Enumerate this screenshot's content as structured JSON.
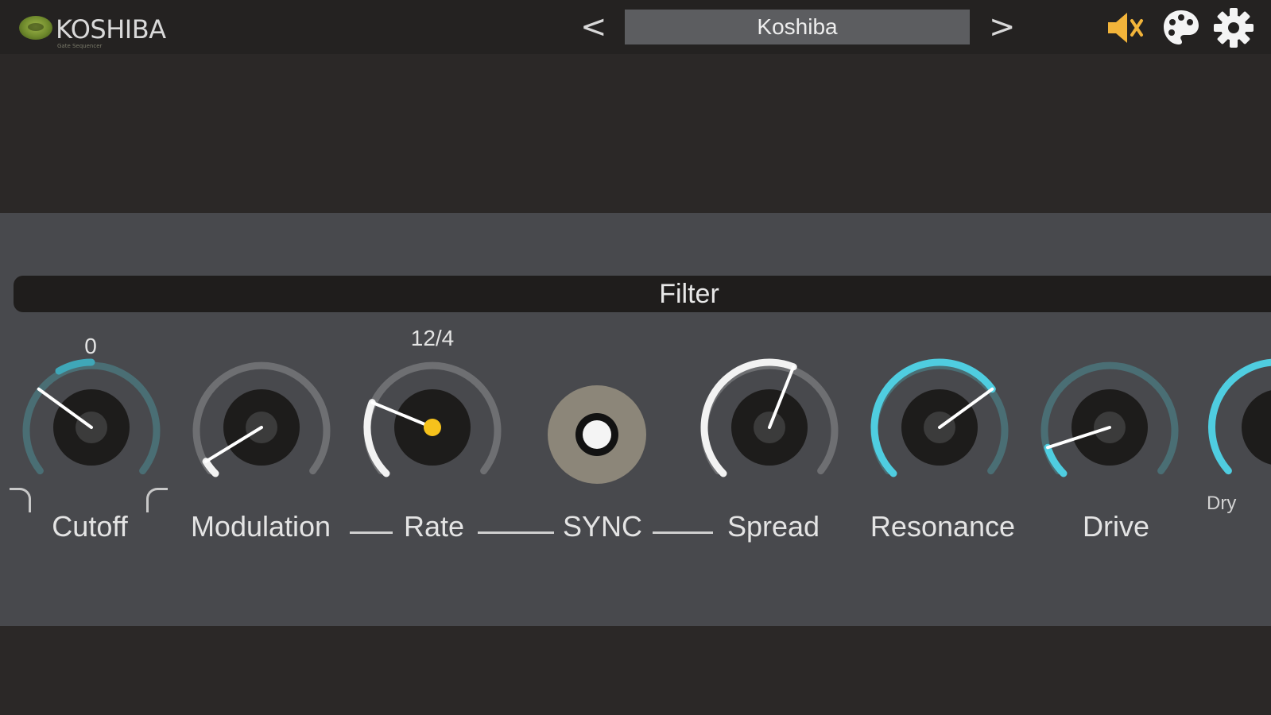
{
  "app": {
    "logo_text": "KOSHIBA",
    "logo_subtitle": "Gate Sequencer"
  },
  "header": {
    "prev_label": "<",
    "next_label": ">",
    "preset_name": "Koshiba",
    "icons": [
      "speaker-mute-icon",
      "palette-icon",
      "gear-icon"
    ]
  },
  "filter": {
    "title": "Filter",
    "dry_label": "Dry",
    "knobs": [
      {
        "label": "Cutoff",
        "value_text": "0",
        "level": 0.5,
        "arc": "teal"
      },
      {
        "label": "Modulation",
        "level": 0.05,
        "arc": "white"
      },
      {
        "label": "Rate",
        "value_text": "12/4",
        "level": 0.25,
        "arc": "white",
        "center_dot": true
      },
      {
        "label": "SYNC",
        "type": "toggle",
        "on": true
      },
      {
        "label": "Spread",
        "level": 0.58,
        "arc": "white"
      },
      {
        "label": "Resonance",
        "level": 0.7,
        "arc": "cyan"
      },
      {
        "label": "Drive",
        "level": 0.1,
        "arc": "cyan"
      }
    ]
  },
  "colors": {
    "accent_cyan": "#4fcde0",
    "accent_teal": "#3fa7b8",
    "rate_dot": "#f6c21c",
    "mute_icon": "#f2b43a"
  }
}
